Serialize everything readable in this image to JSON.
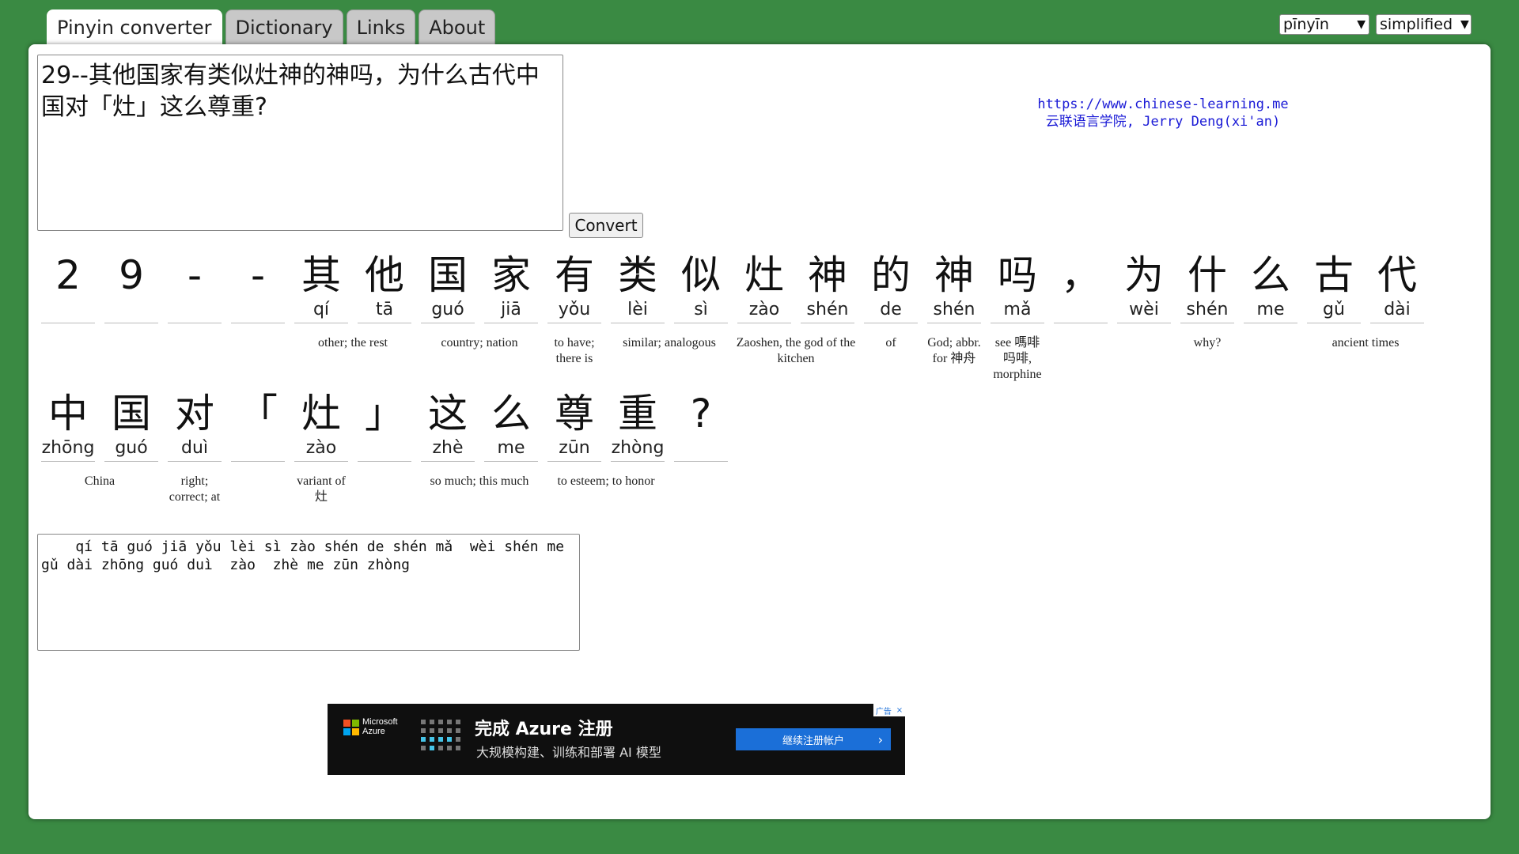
{
  "tabs": [
    "Pinyin converter",
    "Dictionary",
    "Links",
    "About"
  ],
  "selects": {
    "mode": "pīnyīn",
    "script": "simplified"
  },
  "input_text": "29--其他国家有类似灶神的神吗，为什么古代中国对「灶」这么尊重?",
  "convert_label": "Convert",
  "site": {
    "url": "https://www.chinese-learning.me",
    "credit": "云联语言学院, Jerry Deng(xi'an)"
  },
  "row1": [
    {
      "h": "2",
      "p": ""
    },
    {
      "h": "9",
      "p": ""
    },
    {
      "h": "-",
      "p": ""
    },
    {
      "h": "-",
      "p": ""
    },
    {
      "h": "其",
      "p": "qí"
    },
    {
      "h": "他",
      "p": "tā"
    },
    {
      "h": "国",
      "p": "guó"
    },
    {
      "h": "家",
      "p": "jiā"
    },
    {
      "h": "有",
      "p": "yǒu"
    },
    {
      "h": "类",
      "p": "lèi"
    },
    {
      "h": "似",
      "p": "sì"
    },
    {
      "h": "灶",
      "p": "zào"
    },
    {
      "h": "神",
      "p": "shén"
    },
    {
      "h": "的",
      "p": "de"
    },
    {
      "h": "神",
      "p": "shén"
    },
    {
      "h": "吗",
      "p": "mǎ"
    },
    {
      "h": "，",
      "p": ""
    },
    {
      "h": "为",
      "p": "wèi"
    },
    {
      "h": "什",
      "p": "shén"
    },
    {
      "h": "么",
      "p": "me"
    },
    {
      "h": "古",
      "p": "gǔ"
    },
    {
      "h": "代",
      "p": "dài"
    }
  ],
  "row1_gloss": [
    {
      "text": "other; the rest"
    },
    {
      "text": "country; nation"
    },
    {
      "text": "to have; there is"
    },
    {
      "text": "similar; analogous"
    },
    {
      "text": "Zaoshen, the god of the kitchen"
    },
    {
      "text": "of"
    },
    {
      "text": "God; abbr. for 神舟"
    },
    {
      "text": "see 嗎啡 吗啡, morphine"
    },
    {
      "text": "why?"
    },
    {
      "text": "ancient times"
    }
  ],
  "row2": [
    {
      "h": "中",
      "p": "zhōng"
    },
    {
      "h": "国",
      "p": "guó"
    },
    {
      "h": "对",
      "p": "duì"
    },
    {
      "h": "「",
      "p": ""
    },
    {
      "h": "灶",
      "p": "zào"
    },
    {
      "h": "」",
      "p": ""
    },
    {
      "h": "这",
      "p": "zhè"
    },
    {
      "h": "么",
      "p": "me"
    },
    {
      "h": "尊",
      "p": "zūn"
    },
    {
      "h": "重",
      "p": "zhòng"
    },
    {
      "h": "?",
      "p": ""
    }
  ],
  "row2_gloss": [
    {
      "text": "China"
    },
    {
      "text": "right; correct; at"
    },
    {
      "text": "variant of 灶"
    },
    {
      "text": "so much; this much"
    },
    {
      "text": "to esteem; to honor"
    }
  ],
  "output_text": "    qí tā guó jiā yǒu lèi sì zào shén de shén mǎ  wèi shén me\ngǔ dài zhōng guó duì  zào  zhè me zūn zhòng",
  "ad": {
    "brand_line1": "Microsoft",
    "brand_line2": "Azure",
    "title": "完成 Azure 注册",
    "subtitle": "大规模构建、训练和部署 AI 模型",
    "cta": "继续注册帐户",
    "badge": "广告",
    "logo_colors": [
      "#f25022",
      "#7fba00",
      "#00a4ef",
      "#ffb900"
    ]
  }
}
